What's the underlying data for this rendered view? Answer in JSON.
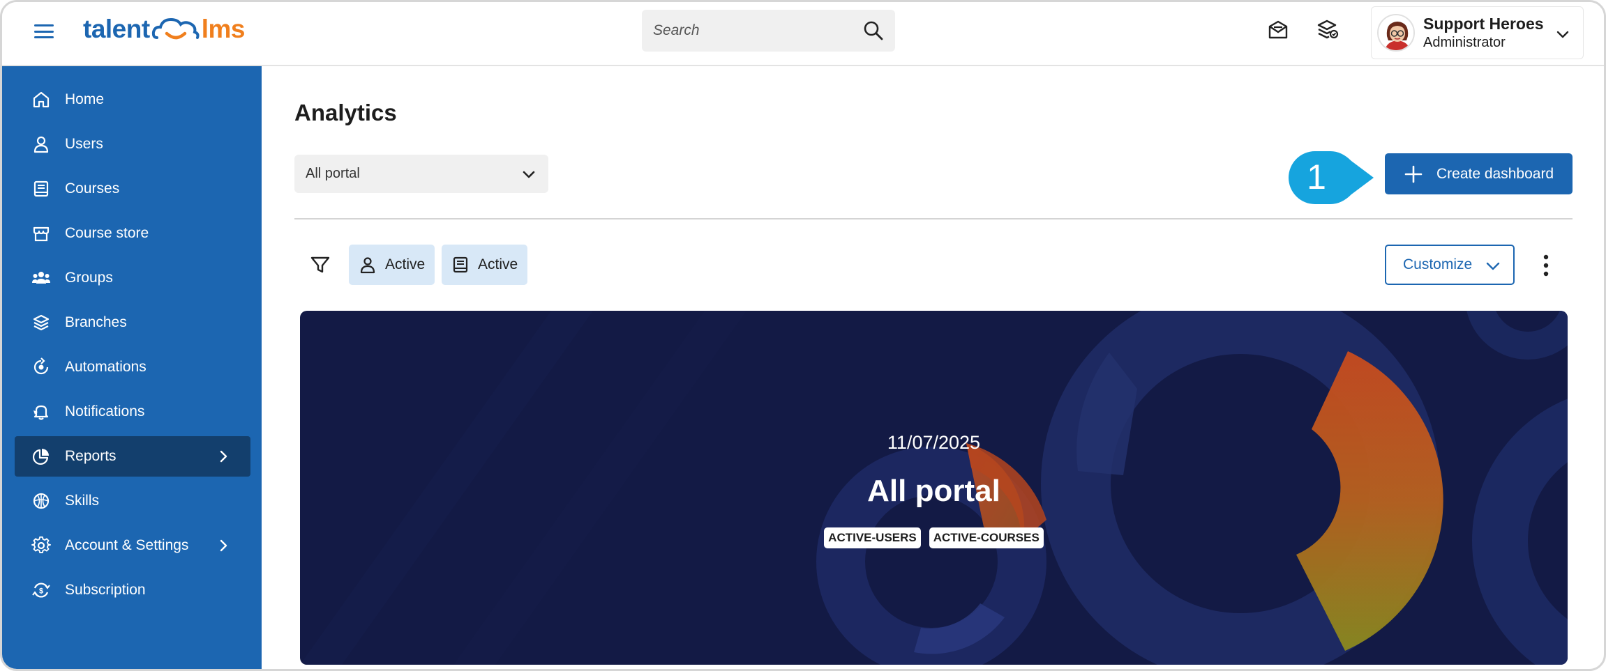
{
  "header": {
    "logo_text_1": "talent",
    "logo_text_2": "lms",
    "search": {
      "placeholder": "Search"
    },
    "user": {
      "name": "Support Heroes",
      "role": "Administrator"
    }
  },
  "sidebar": {
    "items": [
      {
        "label": "Home",
        "icon": "home-icon"
      },
      {
        "label": "Users",
        "icon": "user-icon"
      },
      {
        "label": "Courses",
        "icon": "book-icon"
      },
      {
        "label": "Course store",
        "icon": "store-icon"
      },
      {
        "label": "Groups",
        "icon": "groups-icon"
      },
      {
        "label": "Branches",
        "icon": "layers-icon"
      },
      {
        "label": "Automations",
        "icon": "automation-icon"
      },
      {
        "label": "Notifications",
        "icon": "bell-icon"
      },
      {
        "label": "Reports",
        "icon": "pie-chart-icon",
        "active": true
      },
      {
        "label": "Skills",
        "icon": "skills-icon"
      },
      {
        "label": "Account & Settings",
        "icon": "gear-icon"
      },
      {
        "label": "Subscription",
        "icon": "subscription-icon"
      }
    ]
  },
  "main": {
    "title": "Analytics",
    "portal_select": "All portal",
    "callout_number": "1",
    "create_button": "Create dashboard",
    "filters": [
      {
        "label": "Active",
        "icon": "user-icon"
      },
      {
        "label": "Active",
        "icon": "book-icon"
      }
    ],
    "customize_button": "Customize",
    "banner": {
      "date": "11/07/2025",
      "title": "All portal",
      "tags": [
        "ACTIVE-USERS",
        "ACTIVE-COURSES"
      ]
    }
  },
  "colors": {
    "brand_blue": "#1c66b1",
    "brand_orange": "#f07f1d",
    "sidebar_active": "#133f6d",
    "banner_bg": "#131a45",
    "callout": "#16a4de"
  }
}
